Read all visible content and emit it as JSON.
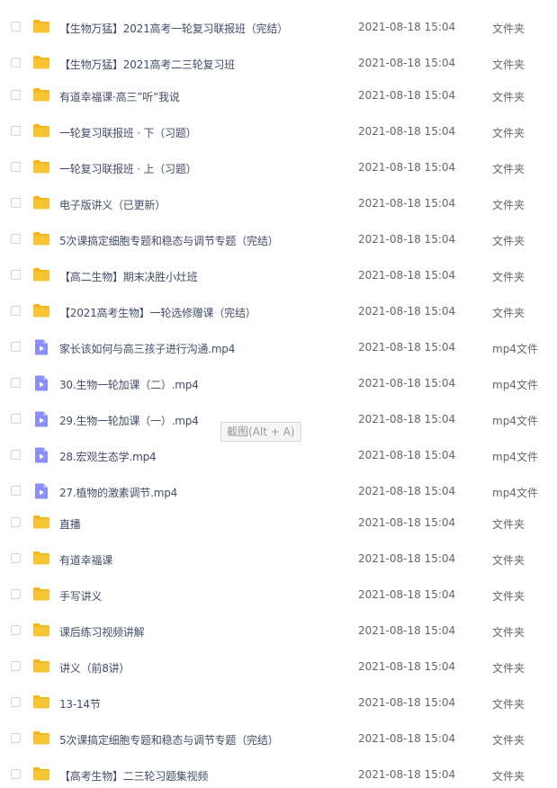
{
  "files": [
    {
      "type": "folder",
      "name": "【生物万猛】2021高考一轮复习联报班（完结）",
      "date": "2021-08-18 15:04",
      "kind": "文件夹"
    },
    {
      "type": "folder",
      "name": "【生物万猛】2021高考二三轮复习班",
      "date": "2021-08-18 15:04",
      "kind": "文件夹"
    },
    {
      "type": "folder",
      "name": "有道幸福课·高三”听”我说",
      "date": "2021-08-18 15:04",
      "kind": "文件夹"
    },
    {
      "type": "folder",
      "name": "一轮复习联报班 · 下（习题）",
      "date": "2021-08-18 15:04",
      "kind": "文件夹"
    },
    {
      "type": "folder",
      "name": "一轮复习联报班 · 上（习题）",
      "date": "2021-08-18 15:04",
      "kind": "文件夹"
    },
    {
      "type": "folder",
      "name": "电子版讲义（已更新）",
      "date": "2021-08-18 15:04",
      "kind": "文件夹"
    },
    {
      "type": "folder",
      "name": "5次课搞定细胞专题和稳态与调节专题（完结）",
      "date": "2021-08-18 15:04",
      "kind": "文件夹"
    },
    {
      "type": "folder",
      "name": "【高二生物】期末决胜小灶班",
      "date": "2021-08-18 15:04",
      "kind": "文件夹"
    },
    {
      "type": "folder",
      "name": "【2021高考生物】一轮选修赠课（完结）",
      "date": "2021-08-18 15:04",
      "kind": "文件夹"
    },
    {
      "type": "video",
      "name": "家长该如何与高三孩子进行沟通.mp4",
      "date": "2021-08-18 15:04",
      "kind": "mp4文件"
    },
    {
      "type": "video",
      "name": "30.生物一轮加课（二）.mp4",
      "date": "2021-08-18 15:04",
      "kind": "mp4文件"
    },
    {
      "type": "video",
      "name": "29.生物一轮加课（一）.mp4",
      "date": "2021-08-18 15:04",
      "kind": "mp4文件"
    },
    {
      "type": "video",
      "name": "28.宏观生态学.mp4",
      "date": "2021-08-18 15:04",
      "kind": "mp4文件"
    },
    {
      "type": "video",
      "name": "27.植物的激素调节.mp4",
      "date": "2021-08-18 15:04",
      "kind": "mp4文件"
    },
    {
      "type": "folder",
      "name": "直播",
      "date": "2021-08-18 15:04",
      "kind": "文件夹"
    },
    {
      "type": "folder",
      "name": "有道幸福课",
      "date": "2021-08-18 15:04",
      "kind": "文件夹"
    },
    {
      "type": "folder",
      "name": "手写讲义",
      "date": "2021-08-18 15:04",
      "kind": "文件夹"
    },
    {
      "type": "folder",
      "name": "课后练习视频讲解",
      "date": "2021-08-18 15:04",
      "kind": "文件夹"
    },
    {
      "type": "folder",
      "name": "讲义（前8讲）",
      "date": "2021-08-18 15:04",
      "kind": "文件夹"
    },
    {
      "type": "folder",
      "name": "13-14节",
      "date": "2021-08-18 15:04",
      "kind": "文件夹"
    },
    {
      "type": "folder",
      "name": "5次课搞定细胞专题和稳态与调节专题（完结）",
      "date": "2021-08-18 15:04",
      "kind": "文件夹"
    },
    {
      "type": "folder",
      "name": "【高考生物】二三轮习题集视频",
      "date": "2021-08-18 15:04",
      "kind": "文件夹"
    }
  ],
  "tooltip": {
    "text": "截图(Alt + A)"
  },
  "colors": {
    "folder": "#f8c334",
    "folder_tab": "#f3b521",
    "video": "#8a8ef6",
    "text": "#424e67"
  }
}
